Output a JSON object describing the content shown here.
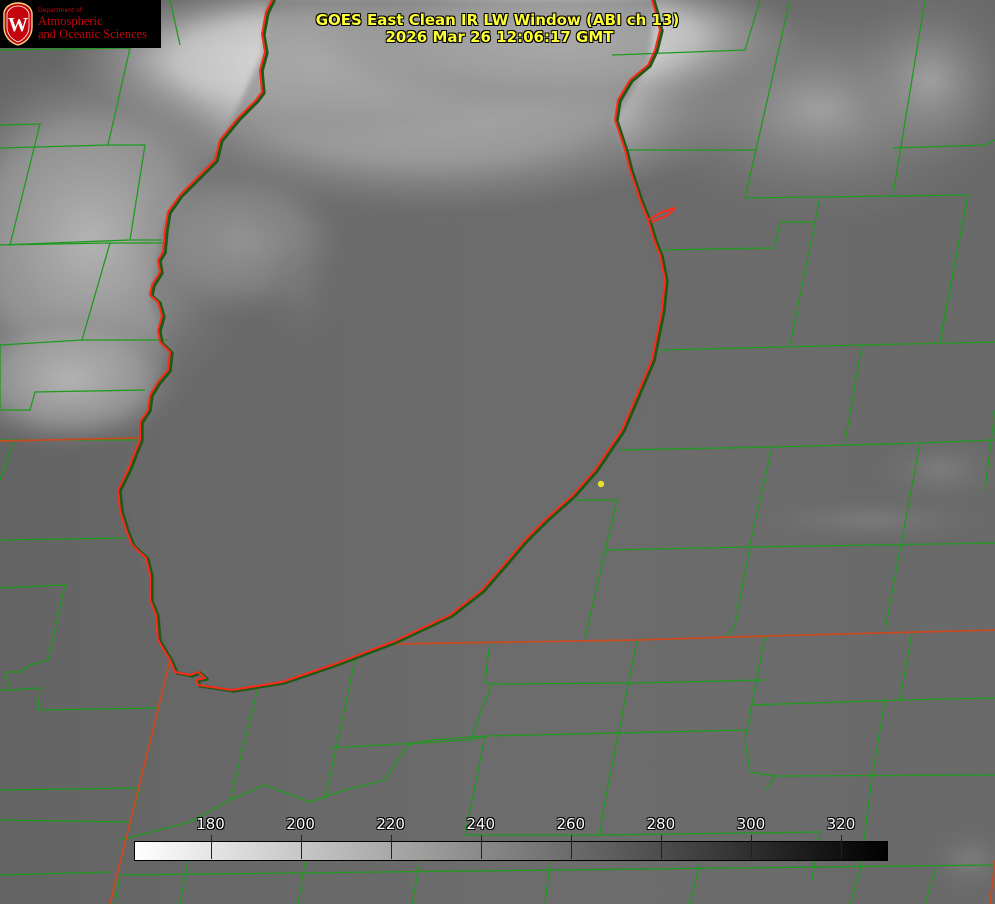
{
  "logo": {
    "department": "Department of",
    "line1": "Atmospheric",
    "line2": "and Oceanic Sciences",
    "seal_letter": "W",
    "seal_color": "#c5050c"
  },
  "title": {
    "line1": "GOES East Clean IR LW Window (ABI ch 13)",
    "line2": "2026 Mar 26 12:06:17 GMT"
  },
  "colorbar": {
    "min": 163,
    "max": 330,
    "gradient": [
      "#ffffff",
      "#000000"
    ],
    "ticks": [
      {
        "value": 180,
        "label": "180"
      },
      {
        "value": 200,
        "label": "200"
      },
      {
        "value": 220,
        "label": "220"
      },
      {
        "value": 240,
        "label": "240"
      },
      {
        "value": 260,
        "label": "260"
      },
      {
        "value": 280,
        "label": "280"
      },
      {
        "value": 300,
        "label": "300"
      },
      {
        "value": 320,
        "label": "320"
      }
    ]
  },
  "map_colors": {
    "base_gray": "#6b6b6b",
    "cloud_light": "#d8d8d8",
    "county_lines": "#1f9a1f",
    "coastline": "#ff2a1a",
    "state_lines": "#c84a1e",
    "marker": "#e5e02a"
  }
}
